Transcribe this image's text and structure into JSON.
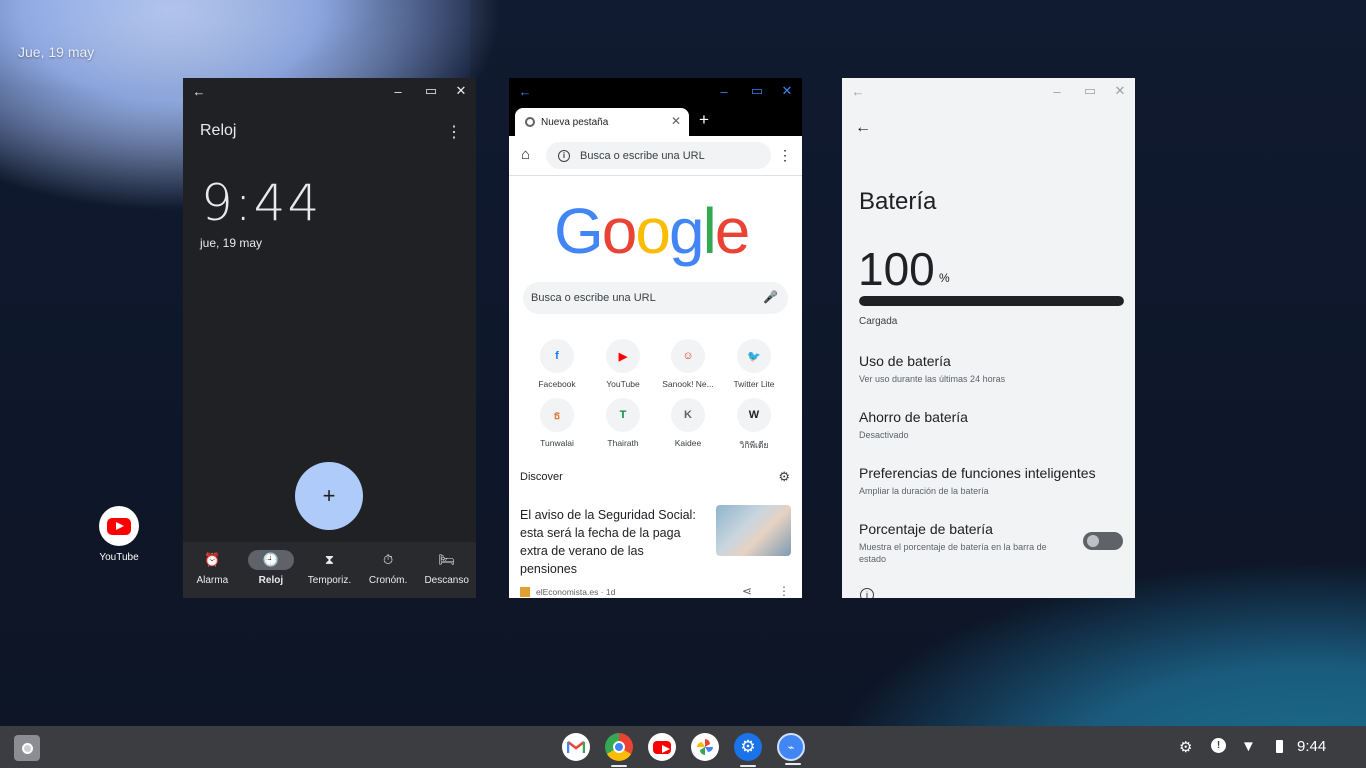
{
  "desktop": {
    "date": "Jue, 19 may",
    "icon_label": "YouTube"
  },
  "clock_app": {
    "title": "Reloj",
    "time": "9:44",
    "date": "jue, 19 may",
    "fab": "+",
    "nav": [
      {
        "label": "Alarma",
        "icon": "alarm-icon",
        "glyph": "⏰"
      },
      {
        "label": "Reloj",
        "icon": "clock-icon",
        "glyph": "🕘"
      },
      {
        "label": "Temporiz.",
        "icon": "hourglass-icon",
        "glyph": "⧗"
      },
      {
        "label": "Cronóm.",
        "icon": "stopwatch-icon",
        "glyph": "⏱"
      },
      {
        "label": "Descanso",
        "icon": "bed-icon",
        "glyph": "🛏"
      }
    ]
  },
  "chrome": {
    "tab_title": "Nueva pestaña",
    "omnibox_placeholder": "Busca o escribe una URL",
    "search_placeholder": "Busca o escribe una URL",
    "tiles": [
      {
        "label": "Facebook",
        "glyph": "f",
        "color": "#1877f2"
      },
      {
        "label": "YouTube",
        "glyph": "▶",
        "color": "#ff0000"
      },
      {
        "label": "Sanook! Ne...",
        "glyph": "☺",
        "color": "#d32f2f"
      },
      {
        "label": "Twitter Lite",
        "glyph": "🐦",
        "color": "#1da1f2"
      },
      {
        "label": "Tunwalai",
        "glyph": "ธ",
        "color": "#e07b39"
      },
      {
        "label": "Thairath",
        "glyph": "T",
        "color": "#0a8f3c"
      },
      {
        "label": "Kaidee",
        "glyph": "K",
        "color": "#5f6368"
      },
      {
        "label": "วิกิพีเดีย",
        "glyph": "W",
        "color": "#202124"
      }
    ],
    "discover_label": "Discover",
    "article_title": "El aviso de la Seguridad Social: esta será la fecha de la paga extra de verano de las pensiones",
    "article_source": "elEconomista.es · 1d"
  },
  "settings": {
    "title": "Batería",
    "percent": "100",
    "percent_sign": "%",
    "level_fraction": 1.0,
    "status": "Cargada",
    "items": [
      {
        "title": "Uso de batería",
        "subtitle": "Ver uso durante las últimas 24 horas"
      },
      {
        "title": "Ahorro de batería",
        "subtitle": "Desactivado"
      },
      {
        "title": "Preferencias de funciones inteligentes",
        "subtitle": "Ampliar la duración de la batería"
      },
      {
        "title": "Porcentaje de batería",
        "subtitle": "Muestra el porcentaje de batería en la barra de estado"
      }
    ]
  },
  "shelf": {
    "apps": [
      "gmail-icon",
      "chrome-icon",
      "youtube-icon",
      "photos-icon",
      "settings-icon",
      "files-icon"
    ],
    "time": "9:44"
  }
}
